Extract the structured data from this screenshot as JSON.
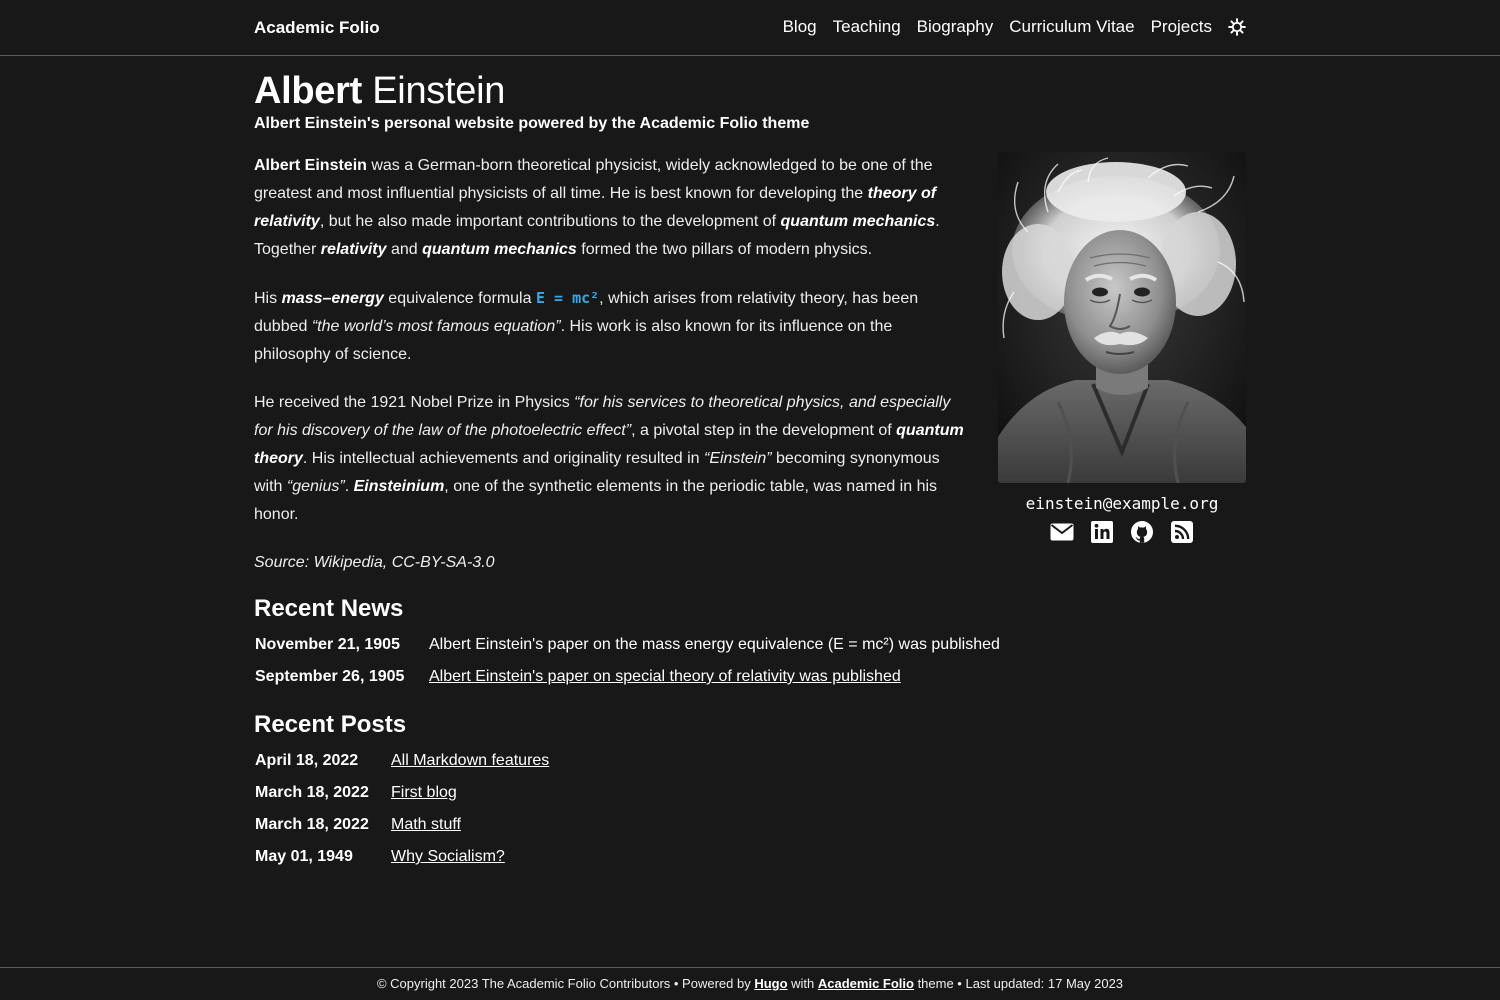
{
  "nav": {
    "brand": "Academic Folio",
    "links": [
      "Blog",
      "Teaching",
      "Biography",
      "Curriculum Vitae",
      "Projects"
    ],
    "theme_icon": "sun-icon"
  },
  "header": {
    "title_first": "Albert",
    "title_last": " Einstein",
    "subtitle": "Albert Einstein's personal website powered by the Academic Folio theme"
  },
  "bio": {
    "p1": {
      "name": "Albert Einstein",
      "t1": " was a German-born theoretical physicist, widely acknowledged to be one of the greatest and most influential physicists of all time. He is best known for developing the ",
      "e1": "theory of relativity",
      "t2": ", but he also made important contributions to the development of ",
      "e2": "quantum mechanics",
      "t3": ". Together ",
      "e3": "relativity",
      "t4": " and ",
      "e4": "quantum mechanics",
      "t5": " formed the two pillars of modern physics."
    },
    "p2": {
      "t1": "His ",
      "e1": "mass–energy",
      "t2": " equivalence formula ",
      "code": "E = mc²",
      "t3": ", which arises from relativity theory, has been dubbed ",
      "i1": "“the world’s most famous equation”",
      "t4": ". His work is also known for its influence on the philosophy of science."
    },
    "p3": {
      "t1": "He received the 1921 Nobel Prize in Physics ",
      "i1": "“for his services to theoretical physics, and especially for his discovery of the law of the photoelectric effect”",
      "t2": ", a pivotal step in the development of ",
      "e1": "quantum theory",
      "t3": ". His intellectual achievements and originality resulted in ",
      "i2": "“Einstein”",
      "t4": " becoming synonymous with ",
      "i3": "“genius”",
      "t5": ". ",
      "e2": "Einsteinium",
      "t6": ", one of the synthetic elements in the periodic table, was named in his honor."
    },
    "source": "Source: Wikipedia, CC-BY-SA-3.0"
  },
  "profile": {
    "email": "einstein@example.org",
    "social_icons": [
      "envelope-icon",
      "linkedin-icon",
      "github-icon",
      "rss-icon"
    ]
  },
  "news": {
    "heading": "Recent News",
    "items": [
      {
        "date": "November 21, 1905",
        "text": "Albert Einstein's paper on the mass energy equivalence (E = mc²) was published"
      },
      {
        "date": "September 26, 1905",
        "text": "Albert Einstein's paper on special theory of relativity was published"
      }
    ]
  },
  "posts": {
    "heading": "Recent Posts",
    "items": [
      {
        "date": "April 18, 2022",
        "title": "All Markdown features"
      },
      {
        "date": "March 18, 2022",
        "title": "First blog"
      },
      {
        "date": "March 18, 2022",
        "title": "Math stuff"
      },
      {
        "date": "May 01, 1949",
        "title": "Why Socialism?"
      }
    ]
  },
  "footer": {
    "t1": "© Copyright 2023 The Academic Folio Contributors • Powered by ",
    "hugo": "Hugo",
    "t2": " with ",
    "theme": "Academic Folio",
    "t3": " theme • Last updated: 17 May 2023"
  }
}
